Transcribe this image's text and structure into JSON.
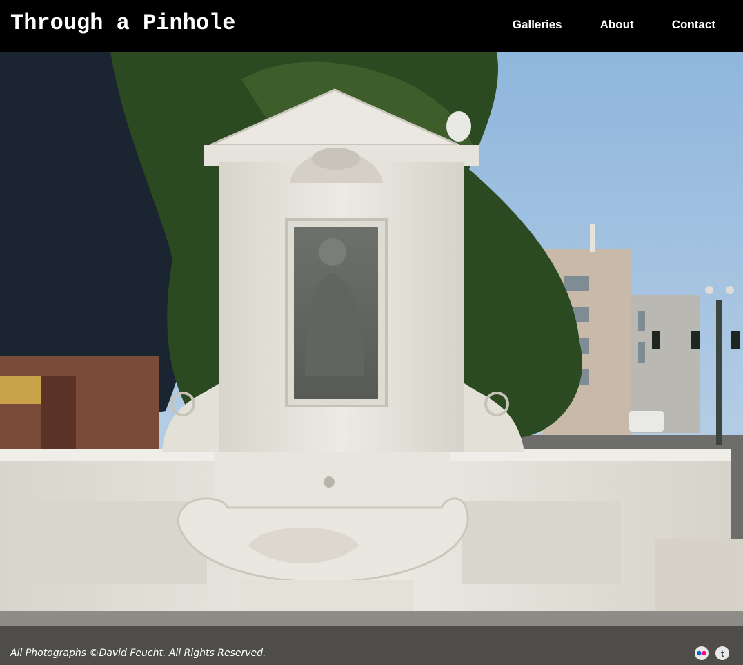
{
  "header": {
    "site_title": "Through a Pinhole",
    "nav": [
      {
        "label": "Galleries"
      },
      {
        "label": "About"
      },
      {
        "label": "Contact"
      }
    ]
  },
  "footer": {
    "copyright": "All Photographs ©David Feucht. All Rights Reserved.",
    "social": [
      {
        "icon": "flickr-icon",
        "colors": [
          "#0063dc",
          "#ff0084"
        ]
      },
      {
        "icon": "tumblr-icon",
        "glyph": "t",
        "color": "#35465c"
      }
    ]
  },
  "colors": {
    "header_bg": "#000000",
    "sky": "#a9c6e2",
    "stone": "#e4e1d8",
    "foliage": "#2c4a22"
  }
}
